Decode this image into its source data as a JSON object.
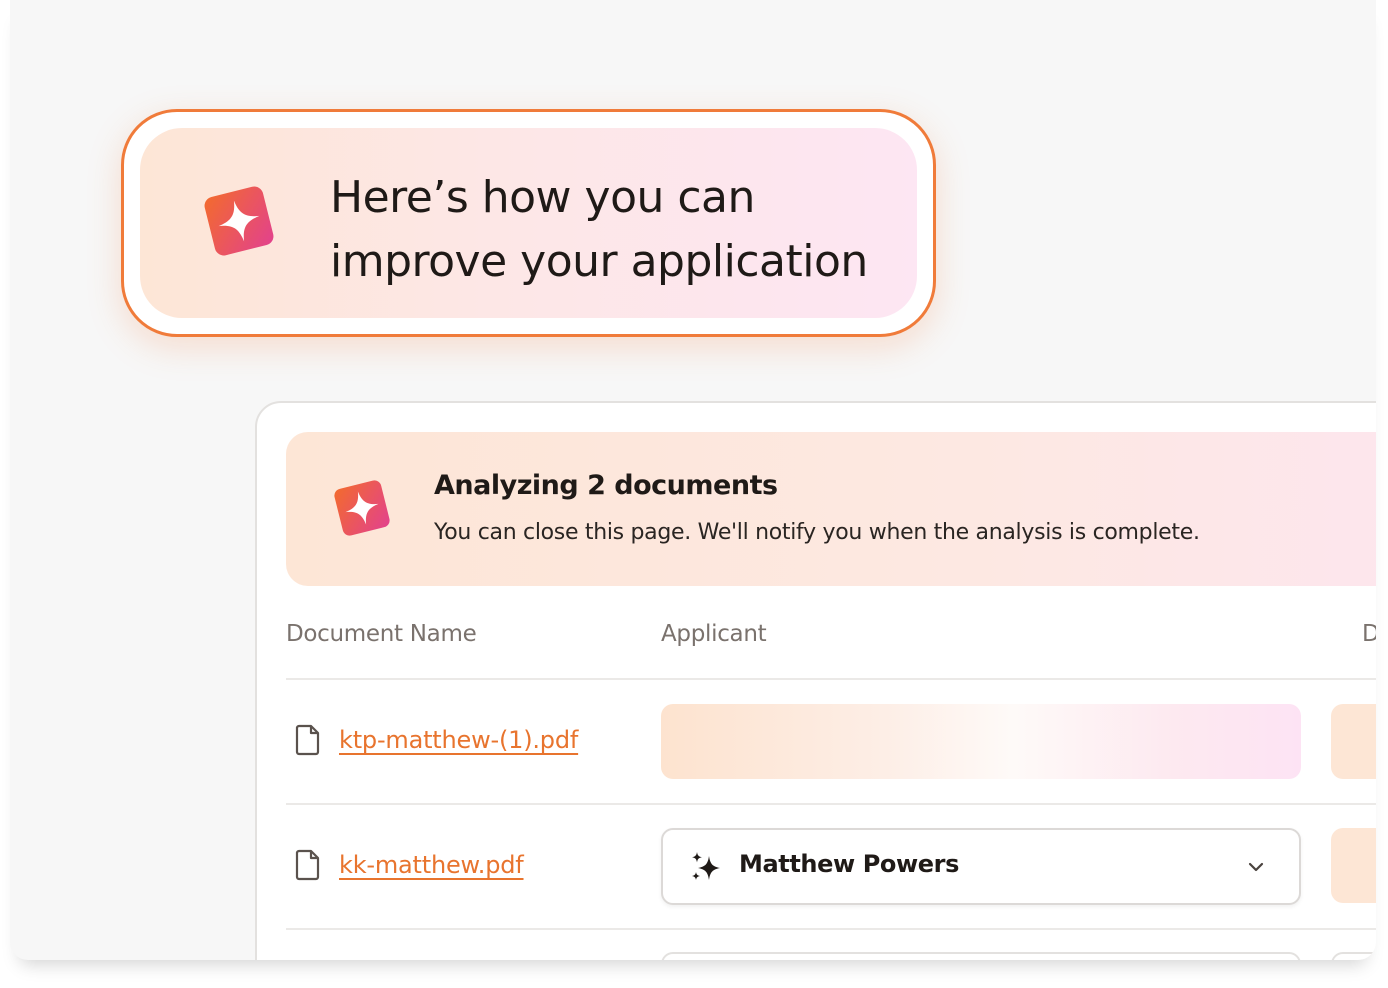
{
  "hero": {
    "line1": "Here’s how you can",
    "line2": "improve your application",
    "icon": "sparkle-badge-icon"
  },
  "banner": {
    "title": "Analyzing 2 documents",
    "subtitle": "You can close this page. We'll notify you when the analysis is complete.",
    "icon": "sparkle-badge-icon"
  },
  "table": {
    "headers": [
      "Document Name",
      "Applicant",
      "D"
    ],
    "rows": [
      {
        "file": "ktp-matthew-(1).pdf",
        "applicant": "",
        "state": "loading"
      },
      {
        "file": "kk-matthew.pdf",
        "applicant": "Matthew Powers",
        "state": "selected"
      }
    ]
  },
  "colors": {
    "accent": "#f07b3a",
    "link": "#e8742e",
    "gradient_start": "#f36b2d",
    "gradient_end": "#e2418e"
  }
}
